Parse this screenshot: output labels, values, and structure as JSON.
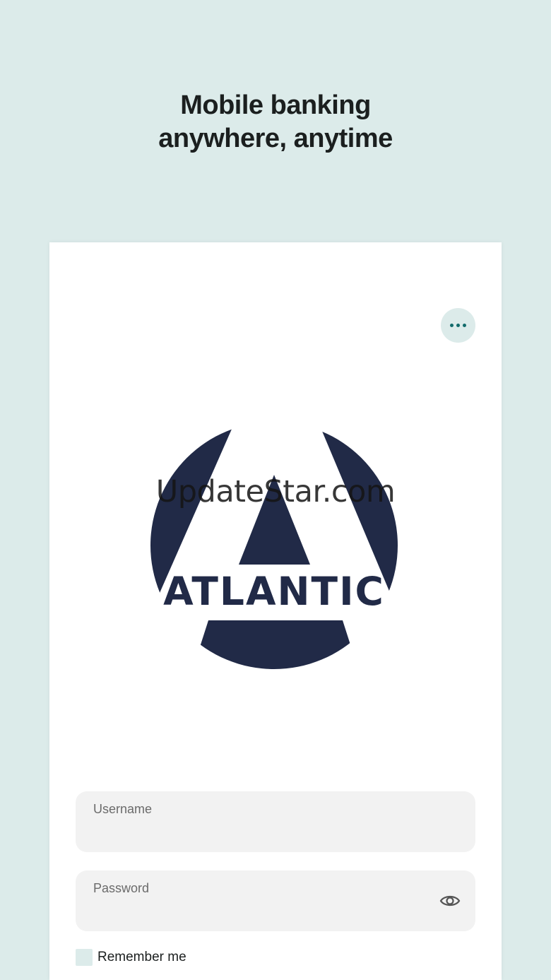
{
  "header": {
    "title_line1": "Mobile banking",
    "title_line2": "anywhere, anytime"
  },
  "card": {
    "more_button": {
      "icon": "more-horizontal-icon"
    },
    "logo": {
      "text": "ATLANTIC"
    },
    "watermark": "UpdateStar.com",
    "username": {
      "label": "Username",
      "value": ""
    },
    "password": {
      "label": "Password",
      "value": "",
      "toggle_icon": "eye-icon"
    },
    "remember_me": {
      "label": "Remember me",
      "checked": false
    }
  },
  "colors": {
    "background": "#dcebea",
    "card": "#ffffff",
    "brand_navy": "#212a47",
    "accent_teal": "#126b6b",
    "field_bg": "#f2f2f2"
  }
}
